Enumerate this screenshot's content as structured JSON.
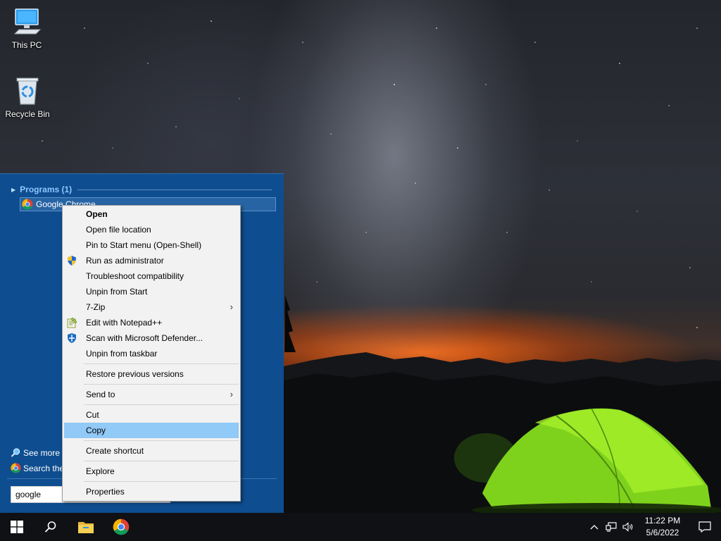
{
  "desktop": {
    "icons": [
      {
        "label": "This PC",
        "icon": "computer-icon"
      },
      {
        "label": "Recycle Bin",
        "icon": "recycle-bin-icon"
      }
    ]
  },
  "start_menu": {
    "programs_header": "Programs (1)",
    "result_label": "Google Chrome",
    "see_more_label": "See more r",
    "search_web_label": "Search the",
    "search_value": "google"
  },
  "context_menu": {
    "items": [
      {
        "label": "Open",
        "bold": true
      },
      {
        "label": "Open file location"
      },
      {
        "label": "Pin to Start menu (Open-Shell)"
      },
      {
        "label": "Run as administrator",
        "icon": "uac-shield-icon"
      },
      {
        "label": "Troubleshoot compatibility"
      },
      {
        "label": "Unpin from Start"
      },
      {
        "label": "7-Zip",
        "submenu": true
      },
      {
        "label": "Edit with Notepad++",
        "icon": "notepad-plus-plus-icon"
      },
      {
        "label": "Scan with Microsoft Defender...",
        "icon": "defender-icon"
      },
      {
        "label": "Unpin from taskbar"
      },
      {
        "label": "Restore previous versions"
      },
      {
        "label": "Send to",
        "submenu": true
      },
      {
        "label": "Cut"
      },
      {
        "label": "Copy",
        "highlighted": true
      },
      {
        "label": "Create shortcut"
      },
      {
        "label": "Explore"
      },
      {
        "label": "Properties"
      }
    ],
    "submenu_glyph": "›"
  },
  "taskbar": {
    "buttons": [
      "windows-start-icon",
      "search-icon",
      "file-explorer-icon",
      "chrome-icon"
    ],
    "tray_icons": [
      "chevron-up-icon",
      "network-icon",
      "volume-icon"
    ],
    "time": "11:22 PM",
    "date": "5/6/2022",
    "notification_icon": "notification-icon"
  }
}
